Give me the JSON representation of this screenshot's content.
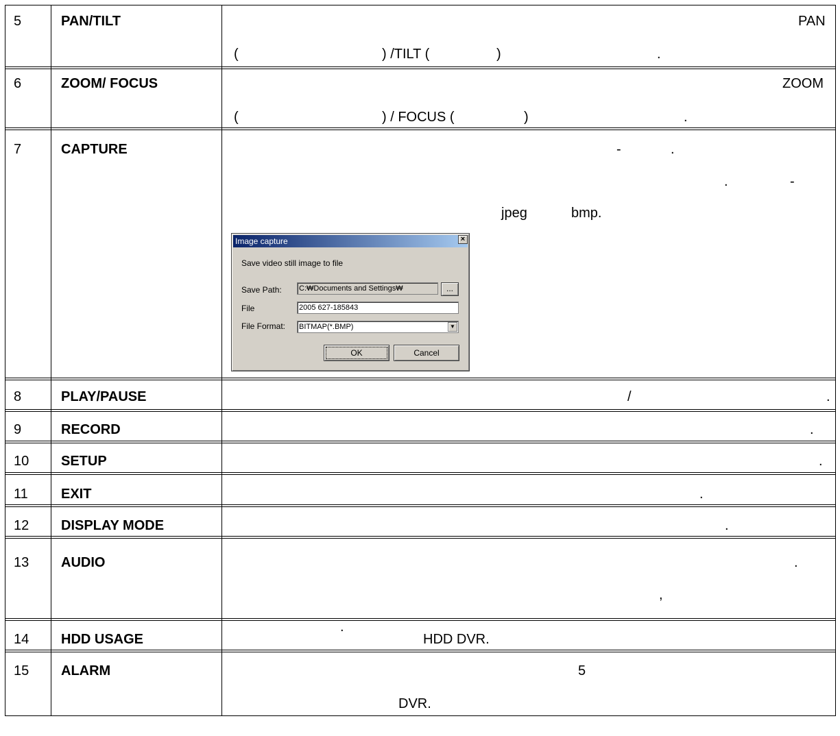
{
  "rows": [
    {
      "num": "5",
      "name": "PAN/TILT",
      "line1": "PAN",
      "line2a": "(",
      "line2b": ") /TILT (",
      "line2c": ")",
      "line2d": "."
    },
    {
      "num": "6",
      "name": "ZOOM/ FOCUS",
      "line1": "ZOOM",
      "line2a": "(",
      "line2b": ") / FOCUS (",
      "line2c": ")",
      "line2d": "."
    },
    {
      "num": "7",
      "name": "CAPTURE",
      "l1a": "-",
      "l1b": ".",
      "l2a": ".",
      "l2b": "-",
      "l3a": "jpeg",
      "l3b": "bmp."
    },
    {
      "num": "8",
      "name": "PLAY/PAUSE",
      "a": "/",
      "b": "."
    },
    {
      "num": "9",
      "name": "RECORD",
      "a": "."
    },
    {
      "num": "10",
      "name": "SETUP",
      "a": "."
    },
    {
      "num": "11",
      "name": "EXIT",
      "a": "."
    },
    {
      "num": "12",
      "name": "DISPLAY MODE",
      "a": "."
    },
    {
      "num": "13",
      "name": "AUDIO",
      "a": ".",
      "b": ",",
      "c": "."
    },
    {
      "num": "14",
      "name": "HDD USAGE",
      "a": "HDD DVR."
    },
    {
      "num": "15",
      "name": "ALARM",
      "a": "5",
      "b": "DVR."
    }
  ],
  "dialog": {
    "title": "Image capture",
    "close": "×",
    "description": "Save video still image to file",
    "save_path_label": "Save Path:",
    "save_path_value": "C:₩Documents and Settings₩",
    "browse_label": "...",
    "file_label": "File",
    "file_value": "2005 627-185843",
    "format_label": "File Format:",
    "format_value": "BITMAP(*.BMP)",
    "ok_label": "OK",
    "cancel_label": "Cancel"
  }
}
